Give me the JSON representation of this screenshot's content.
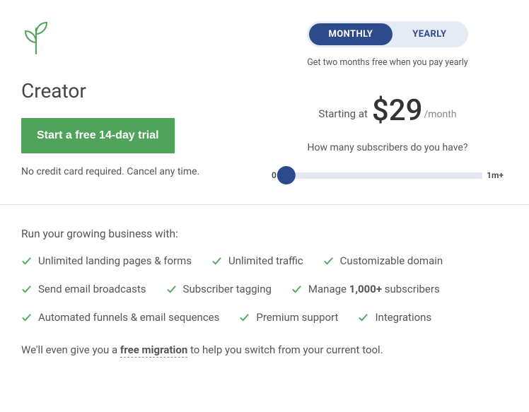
{
  "plan": {
    "title": "Creator",
    "cta_label": "Start a free 14-day trial",
    "note": "No credit card required. Cancel any time."
  },
  "billing_toggle": {
    "monthly": "MONTHLY",
    "yearly": "YEARLY",
    "caption": "Get two months free when you pay yearly"
  },
  "pricing": {
    "starting_at": "Starting at",
    "price": "$29",
    "per": "/month",
    "sub_question": "How many subscribers do you have?",
    "slider_min": "0",
    "slider_max": "1m+"
  },
  "features": {
    "lead": "Run your growing business with:",
    "items": [
      "Unlimited landing pages & forms",
      "Unlimited traffic",
      "Customizable domain",
      "Send email broadcasts",
      "Subscriber tagging",
      "",
      "Automated funnels & email sequences",
      "Premium support",
      "Integrations"
    ],
    "manage_prefix": "Manage ",
    "manage_bold": "1,000+",
    "manage_suffix": " subscribers",
    "migration_pre": "We'll even give you a ",
    "migration_link": "free migration",
    "migration_post": " to help you switch from your current tool."
  }
}
